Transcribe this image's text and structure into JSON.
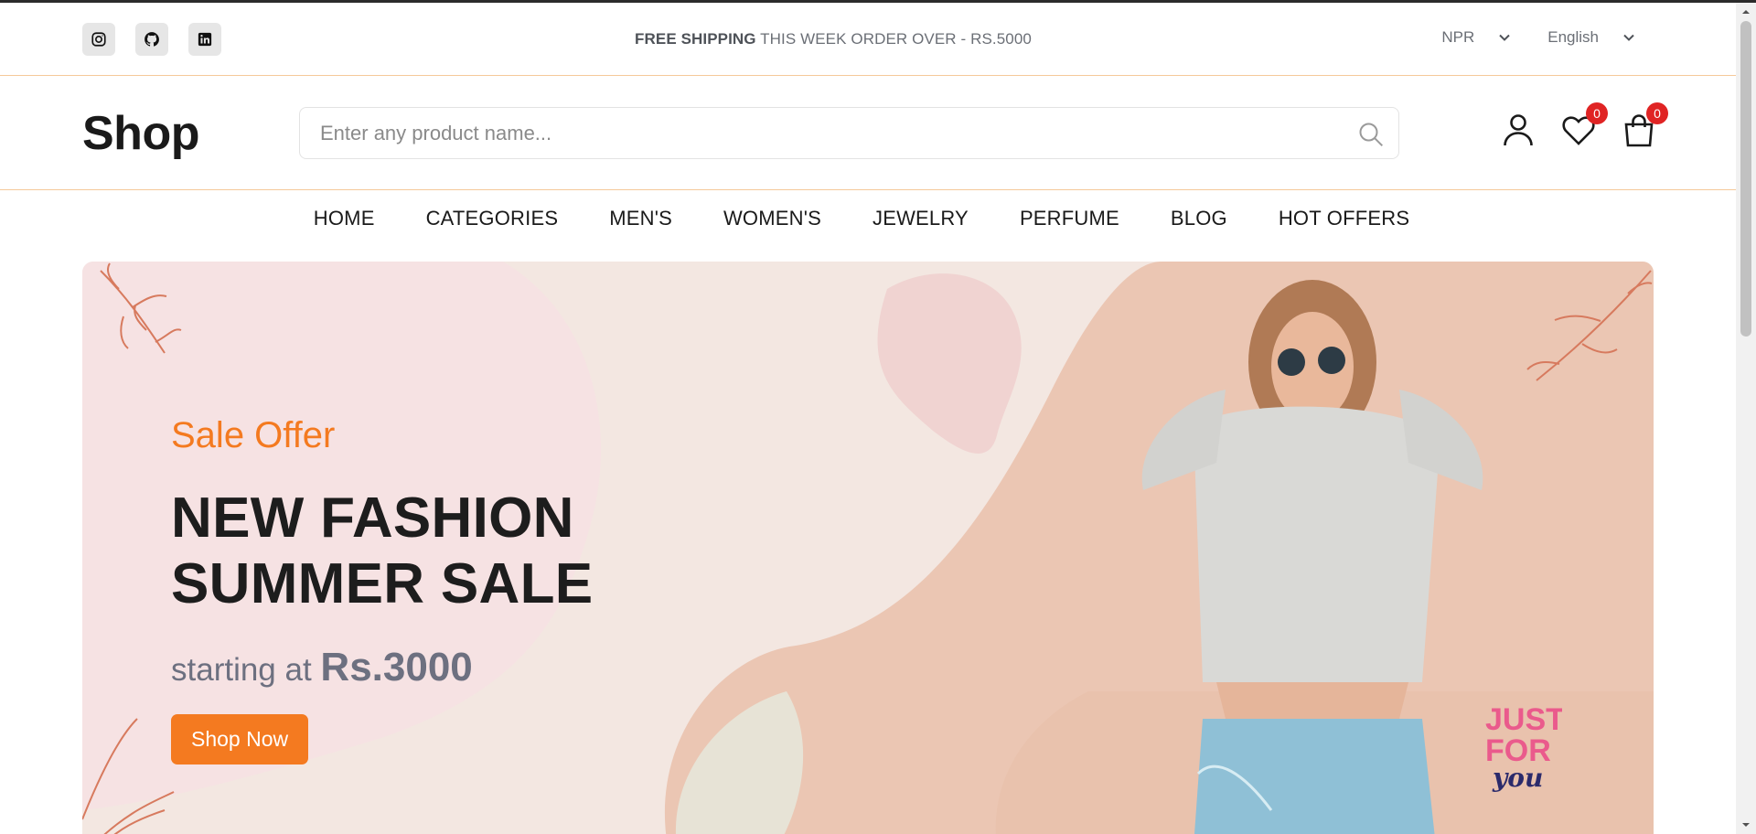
{
  "topbar": {
    "social": [
      {
        "name": "instagram",
        "icon": "instagram-icon"
      },
      {
        "name": "github",
        "icon": "github-icon"
      },
      {
        "name": "linkedin",
        "icon": "linkedin-icon"
      }
    ],
    "announce_strong": "FREE SHIPPING",
    "announce_rest": " THIS WEEK ORDER OVER - RS.5000",
    "currency": "NPR",
    "language": "English"
  },
  "header": {
    "logo": "Shop",
    "search_placeholder": "Enter any product name...",
    "wishlist_count": "0",
    "cart_count": "0"
  },
  "nav": {
    "items": [
      "HOME",
      "CATEGORIES",
      "MEN'S",
      "WOMEN'S",
      "JEWELRY",
      "PERFUME",
      "BLOG",
      "HOT OFFERS"
    ]
  },
  "hero": {
    "kicker": "Sale Offer",
    "title_line1": "NEW FASHION",
    "title_line2": "SUMMER SALE",
    "sub_prefix": "starting at ",
    "price": "Rs.3000",
    "cta": "Shop Now",
    "badge_line1": "JUST",
    "badge_line2": "FOR",
    "badge_line3": "you"
  },
  "colors": {
    "accent": "#f47a20",
    "badge": "#e02424",
    "hero_bg": "#f3e7e1"
  }
}
